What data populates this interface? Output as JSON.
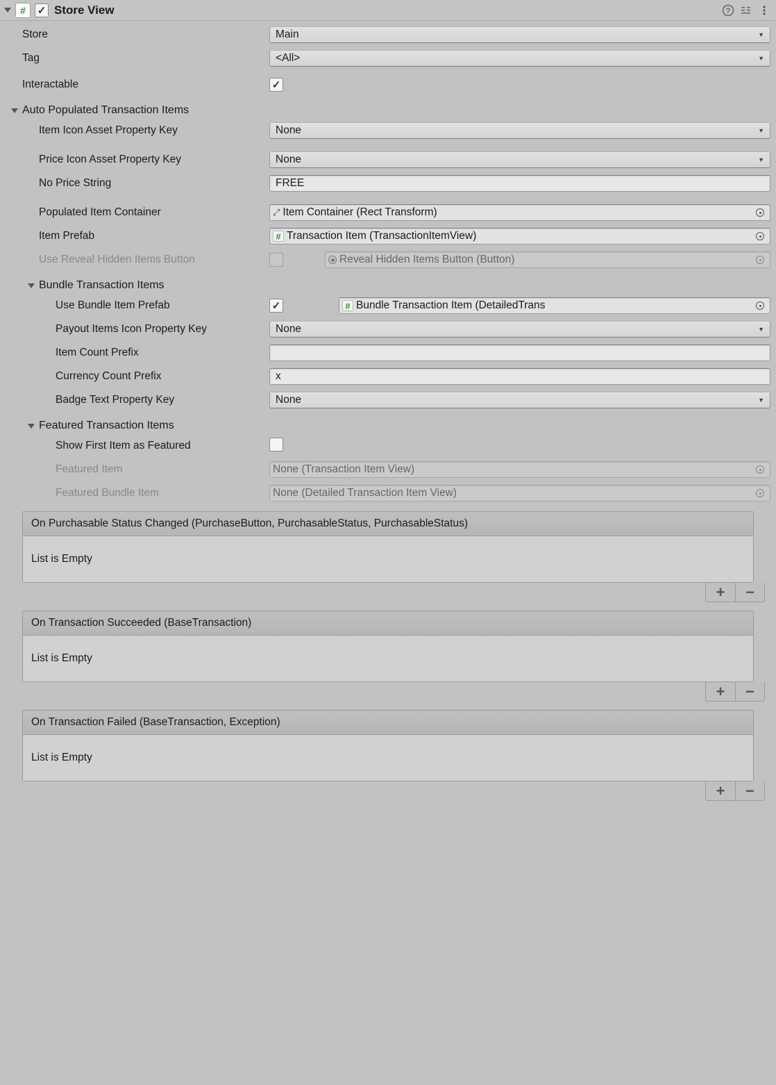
{
  "header": {
    "title": "Store View"
  },
  "store": {
    "label": "Store",
    "value": "Main"
  },
  "tag": {
    "label": "Tag",
    "value": "<All>"
  },
  "interactable": {
    "label": "Interactable"
  },
  "autoPopulated": {
    "title": "Auto Populated Transaction Items",
    "itemIconKey": {
      "label": "Item Icon Asset Property Key",
      "value": "None"
    },
    "priceIconKey": {
      "label": "Price Icon Asset Property Key",
      "value": "None"
    },
    "noPriceString": {
      "label": "No Price String",
      "value": "FREE"
    },
    "populatedItemContainer": {
      "label": "Populated Item Container",
      "value": "Item Container (Rect Transform)"
    },
    "itemPrefab": {
      "label": "Item Prefab",
      "value": "Transaction Item (TransactionItemView)"
    },
    "useRevealButton": {
      "label": "Use Reveal Hidden Items Button",
      "value": "Reveal Hidden Items Button (Button)"
    }
  },
  "bundle": {
    "title": "Bundle Transaction Items",
    "usePrefab": {
      "label": "Use Bundle Item Prefab",
      "value": "Bundle Transaction Item (DetailedTrans"
    },
    "payoutKey": {
      "label": "Payout Items Icon Property Key",
      "value": "None"
    },
    "itemCountPrefix": {
      "label": "Item Count Prefix",
      "value": ""
    },
    "currencyCountPrefix": {
      "label": "Currency Count Prefix",
      "value": "x"
    },
    "badgeTextKey": {
      "label": "Badge Text Property Key",
      "value": "None"
    }
  },
  "featured": {
    "title": "Featured Transaction Items",
    "showFirst": {
      "label": "Show First Item as Featured"
    },
    "featuredItem": {
      "label": "Featured Item",
      "value": "None (Transaction Item View)"
    },
    "featuredBundleItem": {
      "label": "Featured Bundle Item",
      "value": "None (Detailed Transaction Item View)"
    }
  },
  "events": {
    "purchasable": {
      "title": "On Purchasable Status Changed (PurchaseButton, PurchasableStatus, PurchasableStatus)",
      "empty": "List is Empty"
    },
    "succeeded": {
      "title": "On Transaction Succeeded (BaseTransaction)",
      "empty": "List is Empty"
    },
    "failed": {
      "title": "On Transaction Failed (BaseTransaction, Exception)",
      "empty": "List is Empty"
    }
  }
}
